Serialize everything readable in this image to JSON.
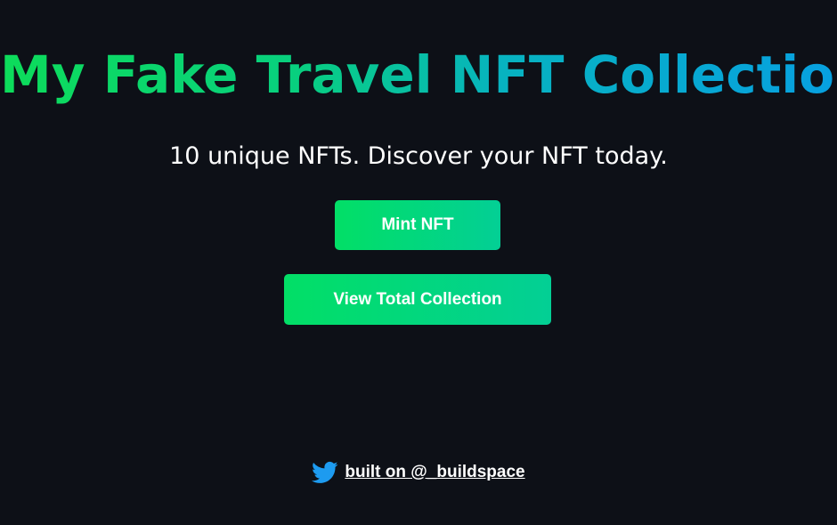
{
  "header": {
    "title": "My Fake Travel NFT Collection",
    "subtitle": "10 unique NFTs. Discover your NFT today."
  },
  "buttons": {
    "mint_label": "Mint NFT",
    "collection_label": "View Total Collection"
  },
  "footer": {
    "icon": "twitter-icon",
    "link_text": "built on @_buildspace"
  },
  "colors": {
    "background": "#0d1017",
    "gradient_start": "#02df66",
    "gradient_end": "#03cf95",
    "title_gradient_end": "#07a0e0",
    "twitter_blue": "#1d9bf0"
  }
}
